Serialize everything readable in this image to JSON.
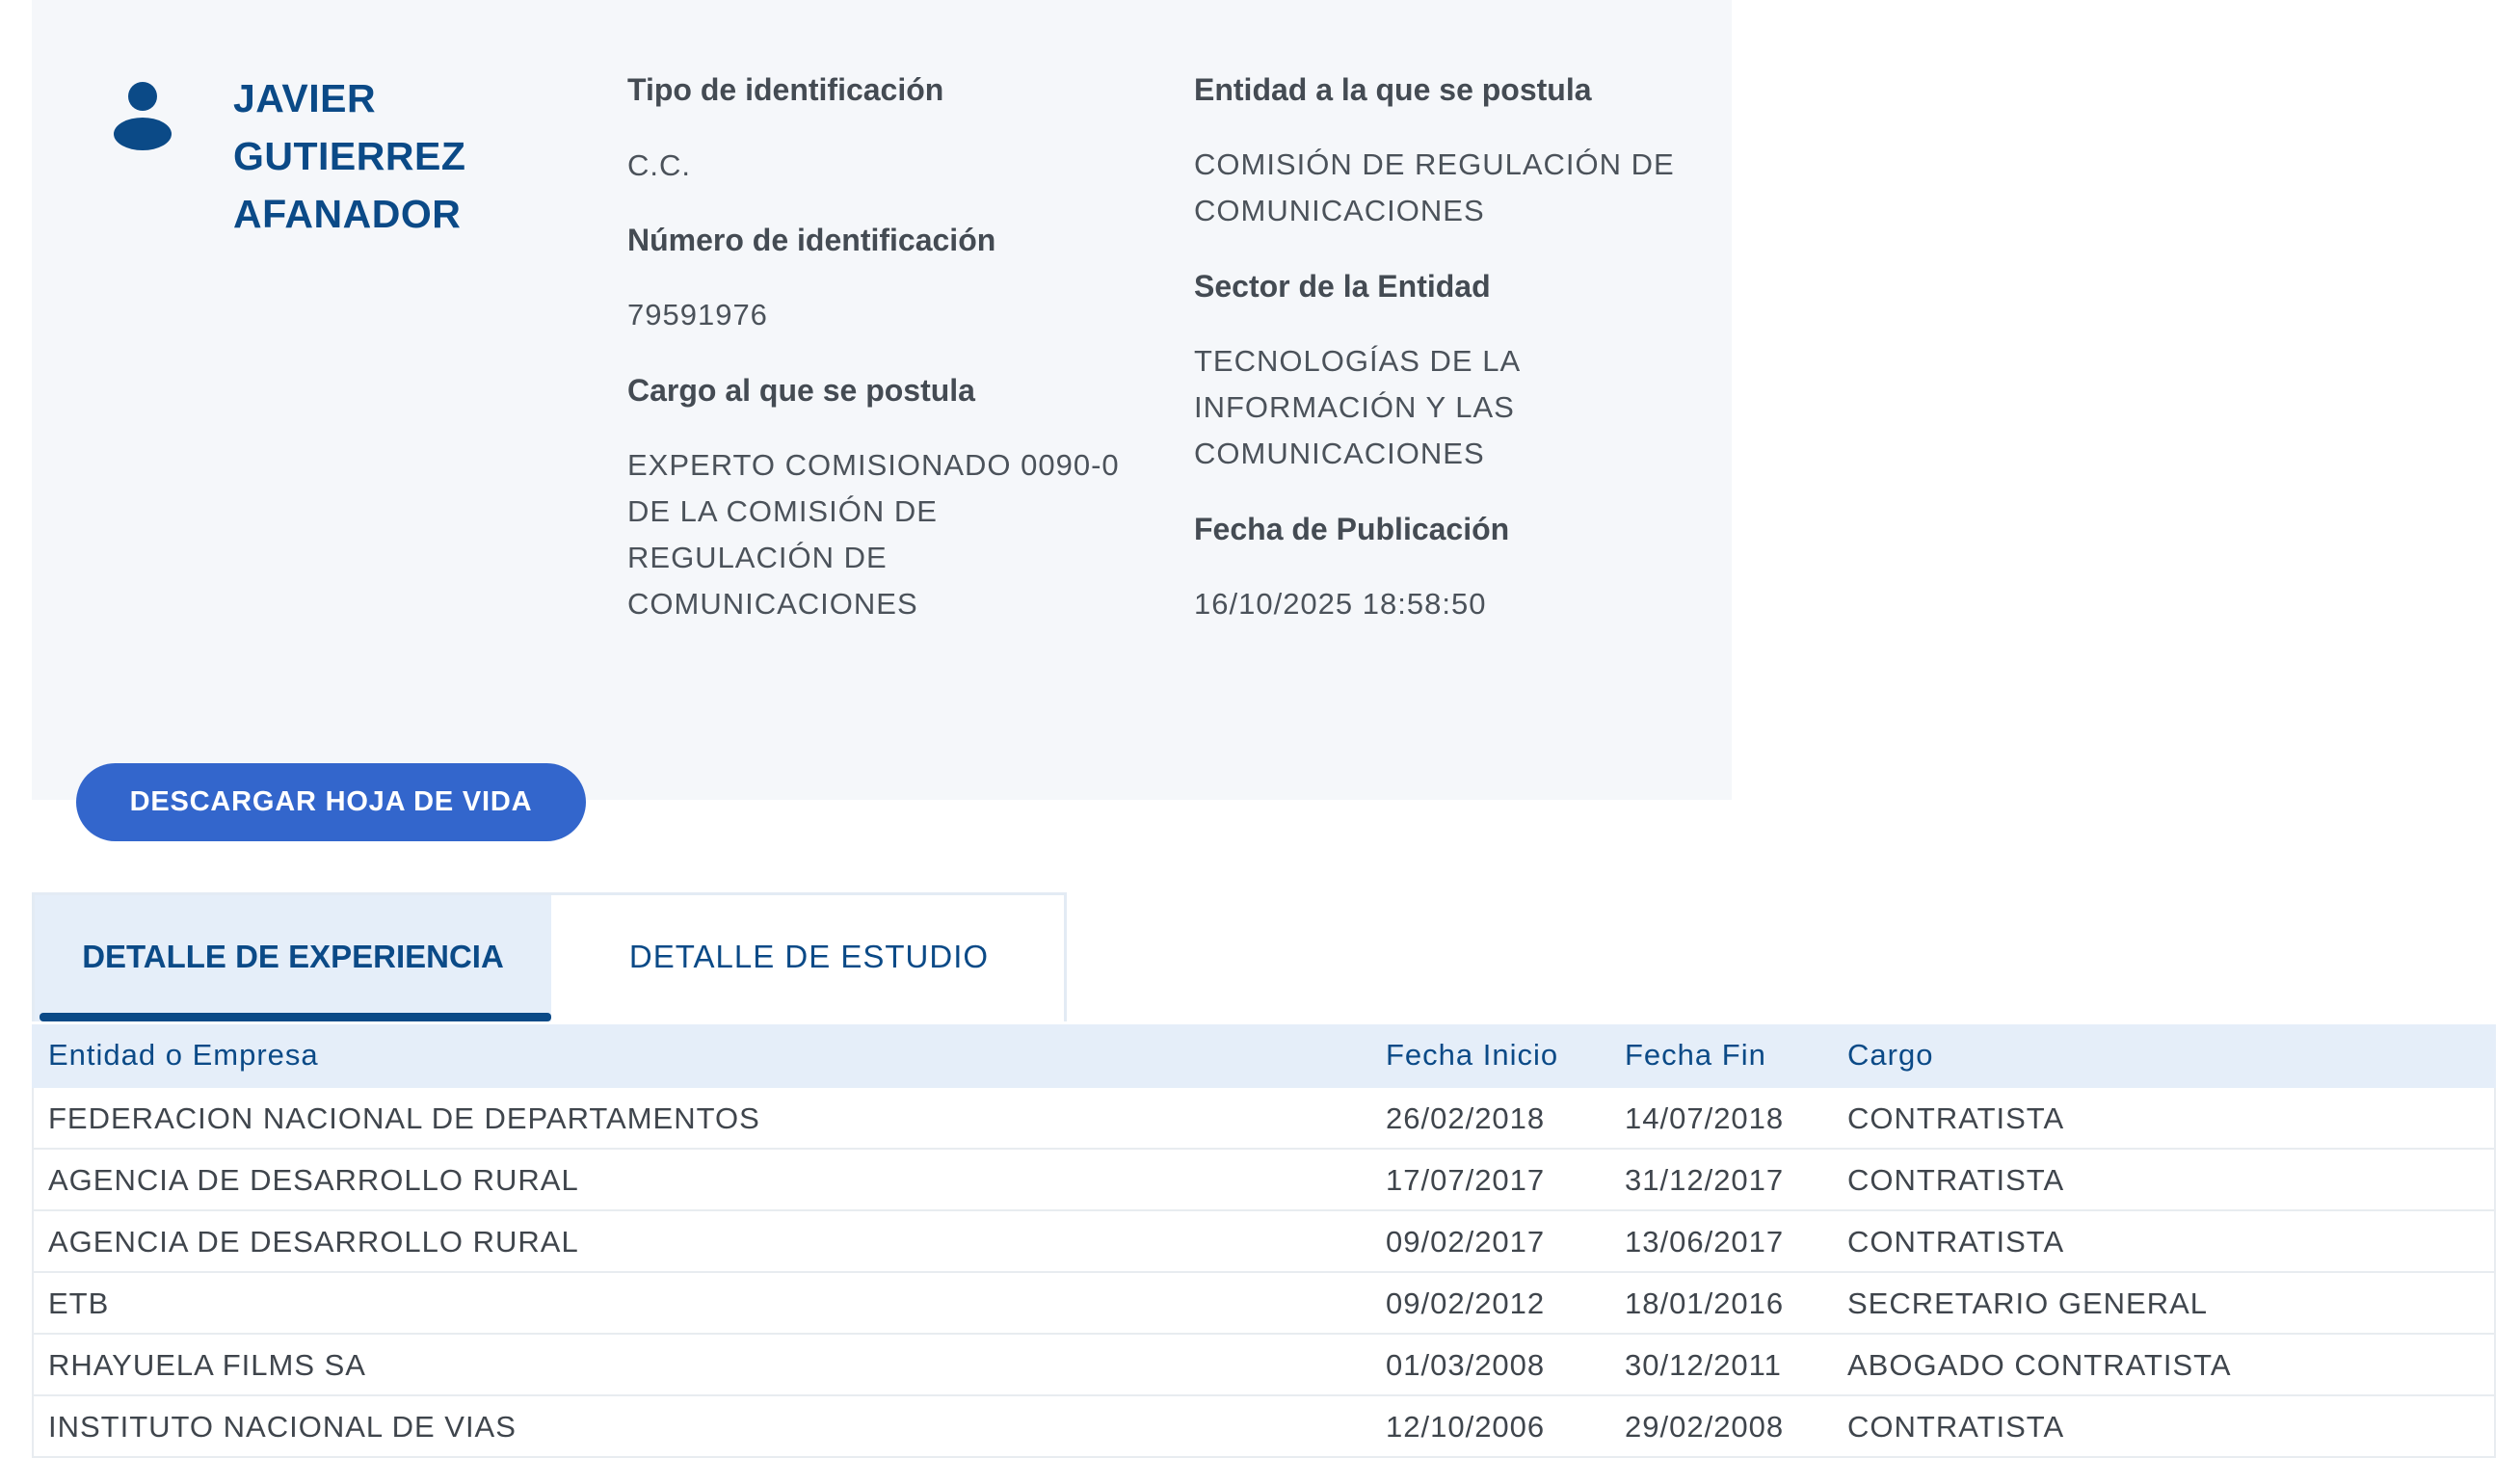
{
  "profile": {
    "name_lines": [
      "JAVIER",
      "GUTIERREZ",
      "AFANADOR"
    ],
    "fields": {
      "tipo_id": {
        "label": "Tipo de identificación",
        "value": "C.C."
      },
      "numero_id": {
        "label": "Número de identificación",
        "value": "79591976"
      },
      "cargo": {
        "label": "Cargo al que se postula",
        "value_lines": [
          "EXPERTO COMISIONADO 0090-0",
          "DE LA COMISIÓN DE",
          "REGULACIÓN DE",
          "COMUNICACIONES"
        ]
      },
      "entidad": {
        "label": "Entidad a la que se postula",
        "value_lines": [
          "COMISIÓN DE REGULACIÓN DE",
          "COMUNICACIONES"
        ]
      },
      "sector": {
        "label": "Sector de la Entidad",
        "value_lines": [
          "TECNOLOGÍAS DE LA",
          "INFORMACIÓN Y LAS",
          "COMUNICACIONES"
        ]
      },
      "fecha_pub": {
        "label": "Fecha de Publicación",
        "value": "16/10/2025 18:58:50"
      }
    },
    "download_label": "DESCARGAR HOJA DE VIDA"
  },
  "tabs": [
    {
      "label": "DETALLE DE EXPERIENCIA",
      "active": true
    },
    {
      "label": "DETALLE DE ESTUDIO",
      "active": false
    }
  ],
  "table": {
    "headers": [
      "Entidad o Empresa",
      "Fecha Inicio",
      "Fecha Fin",
      "Cargo"
    ],
    "rows": [
      [
        "FEDERACION NACIONAL DE DEPARTAMENTOS",
        "26/02/2018",
        "14/07/2018",
        "CONTRATISTA"
      ],
      [
        "AGENCIA DE DESARROLLO RURAL",
        "17/07/2017",
        "31/12/2017",
        "CONTRATISTA"
      ],
      [
        "AGENCIA DE DESARROLLO RURAL",
        "09/02/2017",
        "13/06/2017",
        "CONTRATISTA"
      ],
      [
        "ETB",
        "09/02/2012",
        "18/01/2016",
        "SECRETARIO GENERAL"
      ],
      [
        "RHAYUELA FILMS SA",
        "01/03/2008",
        "30/12/2011",
        "ABOGADO CONTRATISTA"
      ],
      [
        "INSTITUTO NACIONAL DE VIAS",
        "12/10/2006",
        "29/02/2008",
        "CONTRATISTA"
      ]
    ]
  },
  "colors": {
    "accent": "#0b4a87",
    "button": "#3366cc",
    "card_bg": "#f5f7fa",
    "tab_bg": "#e5eef9"
  }
}
